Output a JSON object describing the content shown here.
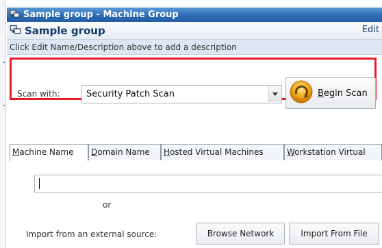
{
  "window": {
    "title": "Sample group - Machine Group",
    "icon": "machine-group-icon"
  },
  "header": {
    "title": "Sample group",
    "edit_label": "Edit",
    "icon": "machine-group-icon"
  },
  "description_hint": "Click Edit Name/Description above to add a description",
  "scan": {
    "label": "Scan with:",
    "selected": "Security Patch Scan",
    "begin_button_prefix": "",
    "begin_button_underline": "B",
    "begin_button_rest": "egin Scan",
    "highlight_color": "#e31c25"
  },
  "tabs": [
    {
      "prefix": "",
      "underline": "M",
      "rest": "achine Name",
      "active": true
    },
    {
      "prefix": "",
      "underline": "D",
      "rest": "omain Name",
      "active": false
    },
    {
      "prefix": "",
      "underline": "H",
      "rest": "osted Virtual Machines",
      "active": false
    },
    {
      "prefix": "",
      "underline": "W",
      "rest": "orkstation Virtual",
      "active": false
    }
  ],
  "machine_entry": {
    "value": ""
  },
  "or_text": "or",
  "import": {
    "label": "Import from an external source:",
    "browse_button": "Browse Network",
    "file_button": "Import From File"
  }
}
